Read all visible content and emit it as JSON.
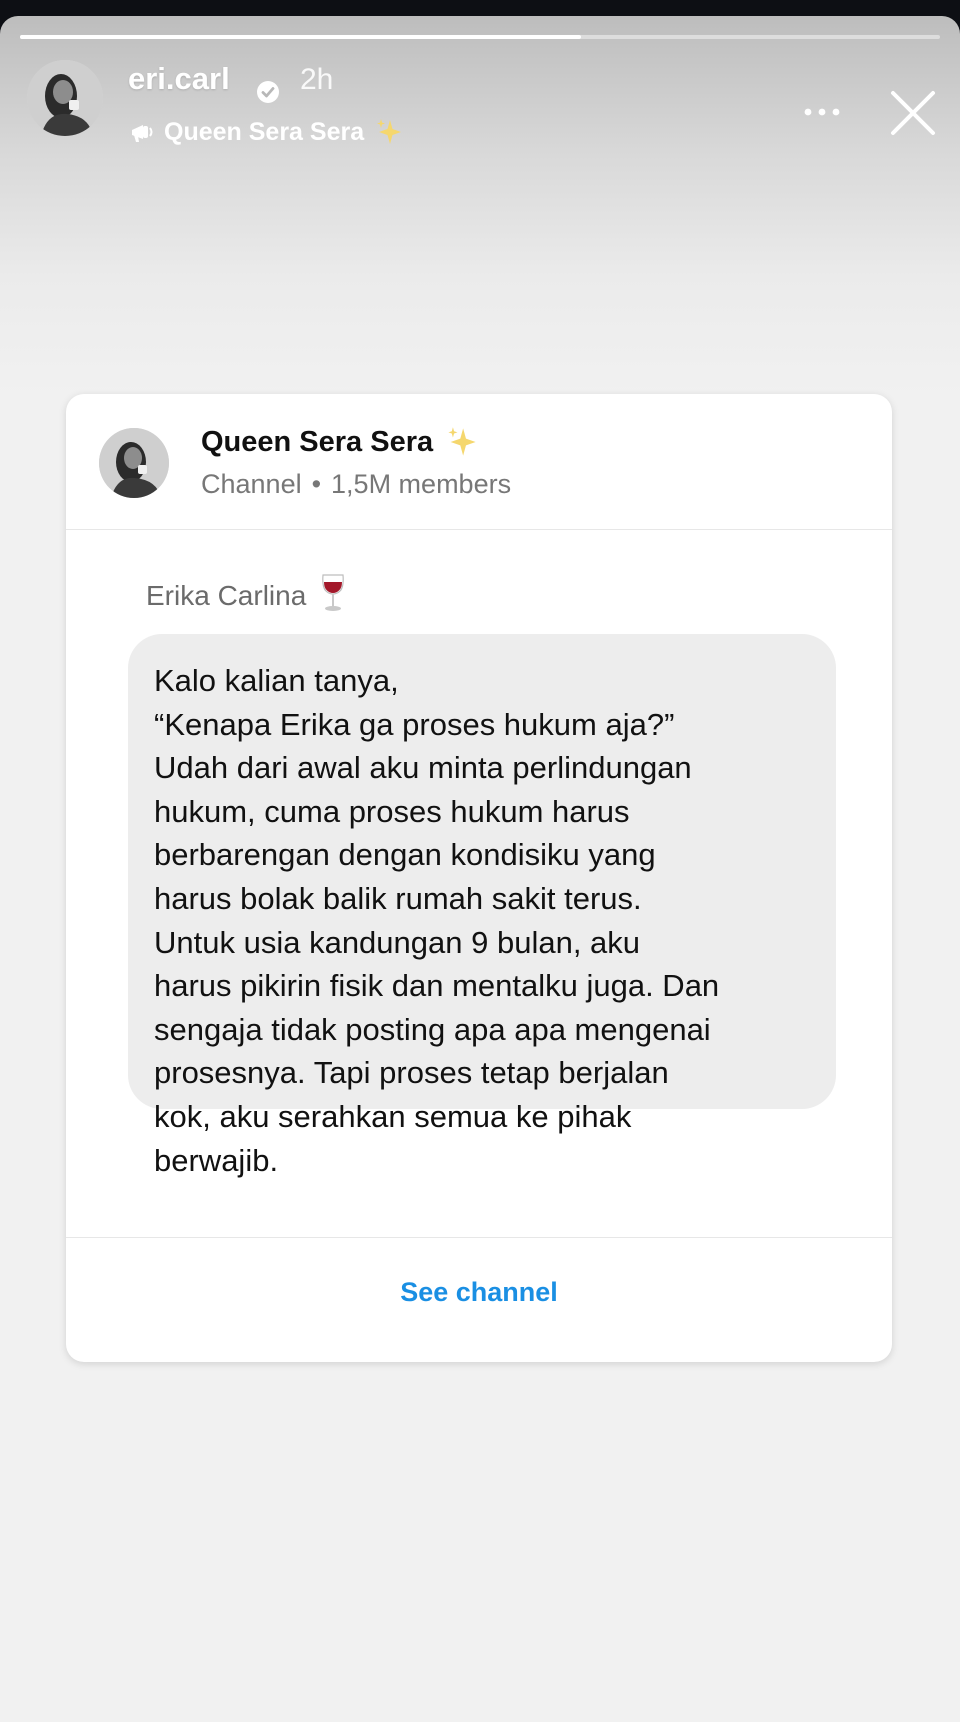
{
  "story": {
    "progress": 0.61,
    "username": "eri.carl",
    "time": "2h",
    "channel_name": "Queen Sera Sera",
    "sparkle": "✨",
    "icons": {
      "verified": "verified-badge-icon",
      "channel": "broadcast-channel-icon",
      "more": "more-horizontal-icon",
      "close": "close-icon"
    }
  },
  "card": {
    "title": "Queen Sera Sera",
    "title_emoji": "✨",
    "type_label": "Channel",
    "separator": "•",
    "members": "1,5M members",
    "sender": "Erika Carlina",
    "sender_emoji": "🍷",
    "message_lines": [
      "Kalo kalian tanya,",
      "“Kenapa Erika ga proses hukum aja?”",
      "Udah dari awal aku minta perlindungan",
      "hukum, cuma proses hukum harus",
      "berbarengan dengan kondisiku yang",
      "harus bolak balik rumah sakit terus.",
      "Untuk usia kandungan 9 bulan, aku",
      "harus pikirin fisik dan mentalku juga. Dan",
      "sengaja tidak posting apa apa mengenai",
      "prosesnya. Tapi proses tetap berjalan",
      "kok, aku serahkan semua ke pihak",
      "berwajib."
    ],
    "cta_label": "See channel",
    "cta_color": "#1a8fe3"
  }
}
